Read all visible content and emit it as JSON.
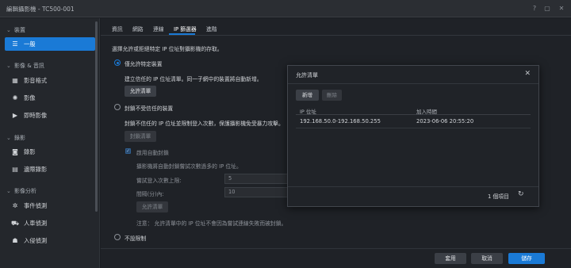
{
  "window": {
    "title": "編輯攝影機 - TC500-001"
  },
  "sidebar": {
    "groups": [
      {
        "label": "裝置",
        "items": [
          {
            "label": "一般",
            "icon": "list-icon"
          }
        ]
      },
      {
        "label": "影像 & 音訊",
        "items": [
          {
            "label": "影音格式",
            "icon": "film-icon"
          },
          {
            "label": "影像",
            "icon": "brightness-icon"
          },
          {
            "label": "即時影像",
            "icon": "play-icon"
          }
        ]
      },
      {
        "label": "錄影",
        "items": [
          {
            "label": "錄影",
            "icon": "record-icon"
          },
          {
            "label": "邊際錄影",
            "icon": "sd-card-icon"
          }
        ]
      },
      {
        "label": "影像分析",
        "items": [
          {
            "label": "事件偵測",
            "icon": "gear-icon"
          },
          {
            "label": "人車偵測",
            "icon": "person-car-icon"
          },
          {
            "label": "入侵偵測",
            "icon": "intrusion-icon"
          }
        ]
      }
    ]
  },
  "tabs": [
    "資訊",
    "網路",
    "連線",
    "IP 篩選器",
    "進階"
  ],
  "content": {
    "intro": "選擇允許或拒絕特定 IP 位址對攝影機的存取。",
    "option_allow": "僅允許特定裝置",
    "allow_desc": "建立信任的 IP 位址清單。同一子網中的裝置將自動新增。",
    "allow_list_btn": "允許清單",
    "option_block": "封鎖不受信任的裝置",
    "block_desc": "封鎖不信任的 IP 位址並限制登入次數，保護攝影機免受暴力攻擊。",
    "block_list_btn": "封鎖清單",
    "auto_block_label": "啟用自動封鎖",
    "auto_block_desc": "攝影機將自動封鎖嘗試次數過多的 IP 位址。",
    "attempts_label": "嘗試登入次數上限:",
    "attempts_value": "5",
    "interval_label": "間隔(分)內:",
    "interval_value": "10",
    "allow_list_btn2": "允許清單",
    "note": "注意： 允許清單中的 IP 位址不會因為嘗試連線失敗而被封鎖。",
    "option_none": "不設限制"
  },
  "footer": {
    "apply": "套用",
    "cancel": "取消",
    "save": "儲存"
  },
  "dialog": {
    "title": "允許清單",
    "add": "新增",
    "delete": "刪除",
    "columns": [
      "IP 位址",
      "加入時間"
    ],
    "rows": [
      {
        "ip": "192.168.50.0-192.168.50.255",
        "time": "2023-06-06 20:55:20"
      }
    ],
    "count": "1 個項目"
  },
  "colors": {
    "accent": "#1a7ad6",
    "background": "#1f2227",
    "sidebar": "#24272c"
  }
}
